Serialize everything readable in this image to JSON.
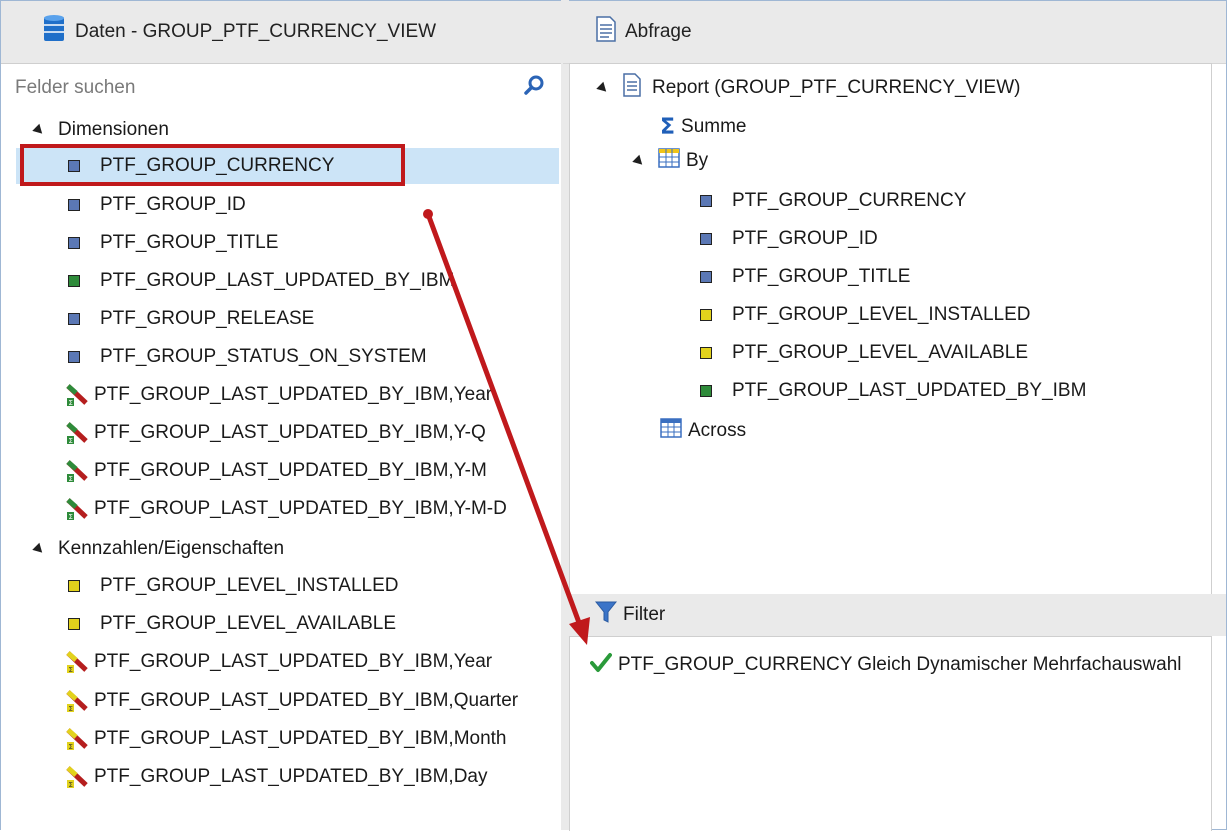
{
  "left_header": {
    "title": "Daten - GROUP_PTF_CURRENCY_VIEW",
    "icon": "database-icon"
  },
  "right_header": {
    "title": "Abfrage",
    "icon": "document-icon"
  },
  "search": {
    "placeholder": "Felder suchen",
    "icon": "search-icon"
  },
  "dimensions": {
    "label": "Dimensionen",
    "items": [
      {
        "label": "PTF_GROUP_CURRENCY",
        "icon": "blue-field-icon"
      },
      {
        "label": "PTF_GROUP_ID",
        "icon": "blue-field-icon"
      },
      {
        "label": "PTF_GROUP_TITLE",
        "icon": "blue-field-icon"
      },
      {
        "label": "PTF_GROUP_LAST_UPDATED_BY_IBM",
        "icon": "green-field-icon"
      },
      {
        "label": "PTF_GROUP_RELEASE",
        "icon": "blue-field-icon"
      },
      {
        "label": "PTF_GROUP_STATUS_ON_SYSTEM",
        "icon": "blue-field-icon"
      },
      {
        "label": "PTF_GROUP_LAST_UPDATED_BY_IBM,Year",
        "icon": "date-hierarchy-icon"
      },
      {
        "label": "PTF_GROUP_LAST_UPDATED_BY_IBM,Y-Q",
        "icon": "date-hierarchy-icon"
      },
      {
        "label": "PTF_GROUP_LAST_UPDATED_BY_IBM,Y-M",
        "icon": "date-hierarchy-icon"
      },
      {
        "label": "PTF_GROUP_LAST_UPDATED_BY_IBM,Y-M-D",
        "icon": "date-hierarchy-icon"
      }
    ]
  },
  "measures": {
    "label": "Kennzahlen/Eigenschaften",
    "items": [
      {
        "label": "PTF_GROUP_LEVEL_INSTALLED",
        "icon": "yellow-field-icon"
      },
      {
        "label": "PTF_GROUP_LEVEL_AVAILABLE",
        "icon": "yellow-field-icon"
      },
      {
        "label": "PTF_GROUP_LAST_UPDATED_BY_IBM,Year",
        "icon": "date-measure-icon"
      },
      {
        "label": "PTF_GROUP_LAST_UPDATED_BY_IBM,Quarter",
        "icon": "date-measure-icon"
      },
      {
        "label": "PTF_GROUP_LAST_UPDATED_BY_IBM,Month",
        "icon": "date-measure-icon"
      },
      {
        "label": "PTF_GROUP_LAST_UPDATED_BY_IBM,Day",
        "icon": "date-measure-icon"
      }
    ]
  },
  "query": {
    "report_label": "Report (GROUP_PTF_CURRENCY_VIEW)",
    "summe_label": "Summe",
    "by_label": "By",
    "by_items": [
      {
        "label": "PTF_GROUP_CURRENCY",
        "icon": "blue-field-icon"
      },
      {
        "label": "PTF_GROUP_ID",
        "icon": "blue-field-icon"
      },
      {
        "label": "PTF_GROUP_TITLE",
        "icon": "blue-field-icon"
      },
      {
        "label": "PTF_GROUP_LEVEL_INSTALLED",
        "icon": "yellow-field-icon"
      },
      {
        "label": "PTF_GROUP_LEVEL_AVAILABLE",
        "icon": "yellow-field-icon"
      },
      {
        "label": "PTF_GROUP_LAST_UPDATED_BY_IBM",
        "icon": "green-field-icon"
      }
    ],
    "across_label": "Across"
  },
  "filter": {
    "header": "Filter",
    "condition": "PTF_GROUP_CURRENCY Gleich Dynamischer Mehrfachauswahl"
  },
  "colors": {
    "highlight": "#c0191c",
    "selection": "#cce4f7",
    "field_blue": "#5b78b5",
    "field_green": "#2e8b3a",
    "field_yellow": "#e2d21c"
  }
}
